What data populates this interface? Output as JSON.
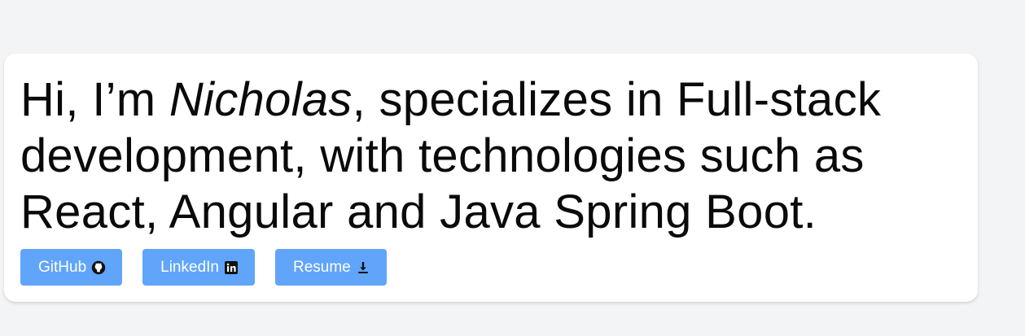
{
  "hero": {
    "greeting": "Hi, I’m ",
    "name": "Nicholas",
    "line1_rest": ", specializes in Full-stack",
    "line2": "development, with technologies such as",
    "line3": "React, Angular and Java Spring Boot."
  },
  "buttons": [
    {
      "label": "GitHub",
      "icon": "github-icon"
    },
    {
      "label": "LinkedIn",
      "icon": "linkedin-icon"
    },
    {
      "label": "Resume",
      "icon": "download-icon"
    }
  ],
  "colors": {
    "background": "#f3f4f6",
    "card": "#ffffff",
    "button": "#60a5fa",
    "text": "#0a0a0a"
  }
}
